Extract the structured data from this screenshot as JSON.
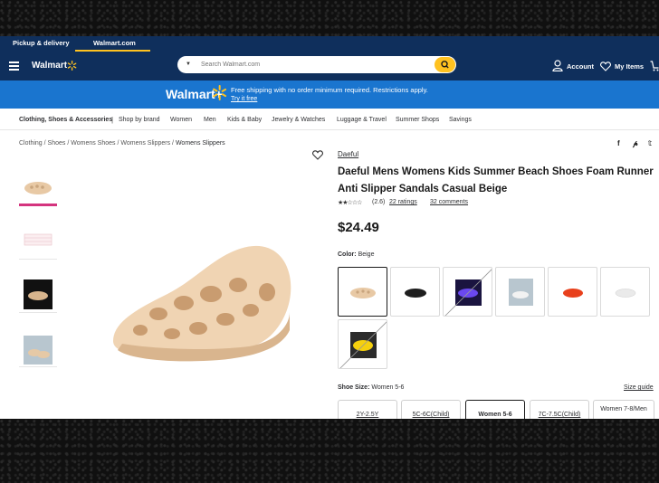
{
  "header": {
    "tabs": [
      "Pickup & delivery",
      "Walmart.com"
    ],
    "brand": "Walmart",
    "search_placeholder": "Search Walmart.com",
    "account_label": "Account",
    "myitems_label": "My Items"
  },
  "promo": {
    "brand": "Walmart+",
    "text": "Free shipping with no order minimum required. Restrictions apply.",
    "link": "Try it free"
  },
  "categories": [
    "Clothing, Shoes & Accessories",
    "Shop by brand",
    "Women",
    "Men",
    "Kids & Baby",
    "Jewelry & Watches",
    "Luggage & Travel",
    "Summer Shops",
    "Savings"
  ],
  "breadcrumb": [
    "Clothing",
    "Shoes",
    "Womens Shoes",
    "Womens Slippers",
    "Womens Slippers"
  ],
  "product": {
    "seller": "Daeful",
    "title": "Daeful Mens Womens Kids Summer Beach Shoes Foam Runner Anti Slipper Sandals Casual Beige",
    "stars": "★★☆☆☆",
    "rating": "(2.6)",
    "ratings_link": "22 ratings",
    "comments_link": "32 comments",
    "price": "$24.49",
    "color_label": "Color:",
    "color_value": "Beige",
    "size_label": "Shoe Size:",
    "size_value": "Women 5-6",
    "size_guide": "Size guide",
    "sizes": [
      "2Y-2.5Y",
      "5C-6C(Child)",
      "Women 5-6",
      "7C-7.5C(Child)",
      "Women 7-8/Men"
    ]
  },
  "colors": {
    "header_bg": "#0f2f5c",
    "promo_bg": "#1a75cf",
    "accent_yellow": "#ffc220",
    "thumb_selected": "#d4347e"
  }
}
